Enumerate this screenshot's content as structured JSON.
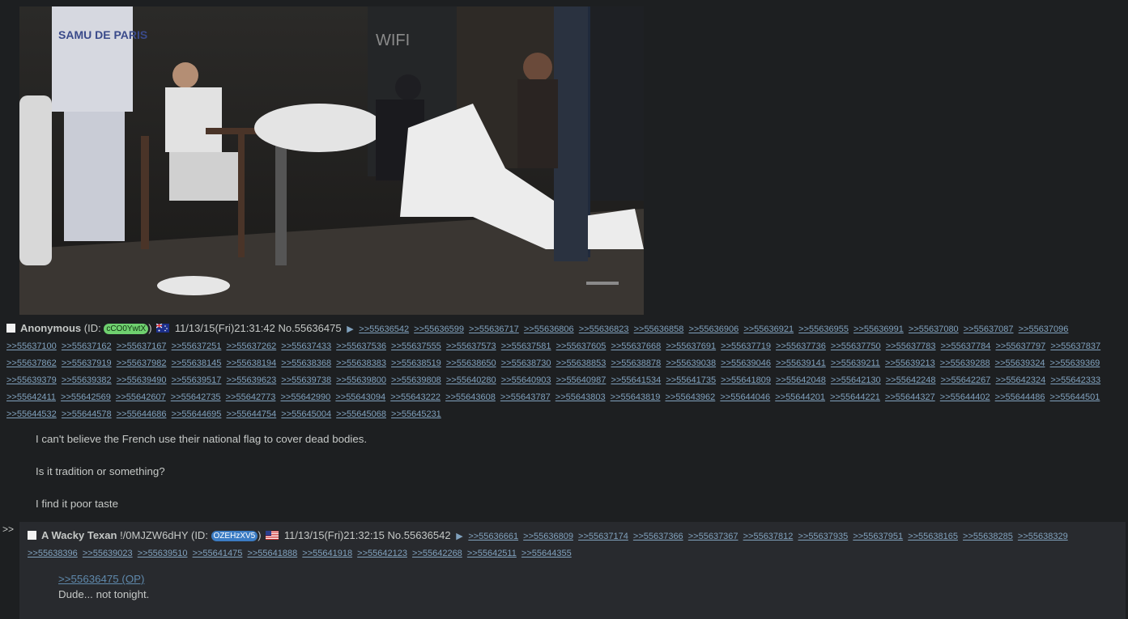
{
  "op": {
    "image": {
      "description_icon": "photo-image",
      "visible_text": "SAMU DE PARIS",
      "wifi_text": "WIFI"
    },
    "name": "Anonymous",
    "id_prefix": "(ID: ",
    "id": "cCO0YwtX",
    "id_suffix": ")",
    "id_color": "#6fd06f",
    "flag_icon": "australia-flag-icon",
    "datetime": "11/13/15(Fri)21:31:42",
    "number": "No.55636475",
    "backlinks": [
      ">>55636542",
      ">>55636599",
      ">>55636717",
      ">>55636806",
      ">>55636823",
      ">>55636858",
      ">>55636906",
      ">>55636921",
      ">>55636955",
      ">>55636991",
      ">>55637080",
      ">>55637087",
      ">>55637096",
      ">>55637100",
      ">>55637162",
      ">>55637167",
      ">>55637251",
      ">>55637262",
      ">>55637433",
      ">>55637536",
      ">>55637555",
      ">>55637573",
      ">>55637581",
      ">>55637605",
      ">>55637668",
      ">>55637691",
      ">>55637719",
      ">>55637736",
      ">>55637750",
      ">>55637783",
      ">>55637784",
      ">>55637797",
      ">>55637837",
      ">>55637862",
      ">>55637919",
      ">>55637982",
      ">>55638145",
      ">>55638194",
      ">>55638368",
      ">>55638383",
      ">>55638519",
      ">>55638650",
      ">>55638730",
      ">>55638853",
      ">>55638878",
      ">>55639038",
      ">>55639046",
      ">>55639141",
      ">>55639211",
      ">>55639213",
      ">>55639288",
      ">>55639324",
      ">>55639369",
      ">>55639379",
      ">>55639382",
      ">>55639490",
      ">>55639517",
      ">>55639623",
      ">>55639738",
      ">>55639800",
      ">>55639808",
      ">>55640280",
      ">>55640903",
      ">>55640987",
      ">>55641534",
      ">>55641735",
      ">>55641809",
      ">>55642048",
      ">>55642130",
      ">>55642248",
      ">>55642267",
      ">>55642324",
      ">>55642333",
      ">>55642411",
      ">>55642569",
      ">>55642607",
      ">>55642735",
      ">>55642773",
      ">>55642990",
      ">>55643094",
      ">>55643222",
      ">>55643608",
      ">>55643787",
      ">>55643803",
      ">>55643819",
      ">>55643962",
      ">>55644046",
      ">>55644201",
      ">>55644221",
      ">>55644327",
      ">>55644402",
      ">>55644486",
      ">>55644501",
      ">>55644532",
      ">>55644578",
      ">>55644686",
      ">>55644695",
      ">>55644754",
      ">>55645004",
      ">>55645068",
      ">>55645231"
    ],
    "message": [
      "I can't believe the French use their national flag to cover dead bodies.",
      "Is it tradition or something?",
      "I find it poor taste"
    ]
  },
  "reply": {
    "side_arrows": ">>",
    "name": "A Wacky Texan",
    "tripcode": "!/0MJZW6dHY",
    "id_prefix": "(ID: ",
    "id": "OZEHzXV5",
    "id_suffix": ")",
    "id_color": "#3b7cc4",
    "flag_icon": "usa-flag-icon",
    "datetime": "11/13/15(Fri)21:32:15",
    "number": "No.55636542",
    "backlinks": [
      ">>55636661",
      ">>55636809",
      ">>55637174",
      ">>55637366",
      ">>55637367",
      ">>55637812",
      ">>55637935",
      ">>55637951",
      ">>55638165",
      ">>55638285",
      ">>55638329",
      ">>55638396",
      ">>55639023",
      ">>55639510",
      ">>55641475",
      ">>55641888",
      ">>55641918",
      ">>55642123",
      ">>55642268",
      ">>55642511",
      ">>55644355"
    ],
    "quote_link": ">>55636475 (OP)",
    "message": "Dude... not tonight."
  },
  "colors": {
    "background": "#1d1f21",
    "reply_background": "#282a2e",
    "link": "#81a2be",
    "text": "#c5c8c6"
  }
}
